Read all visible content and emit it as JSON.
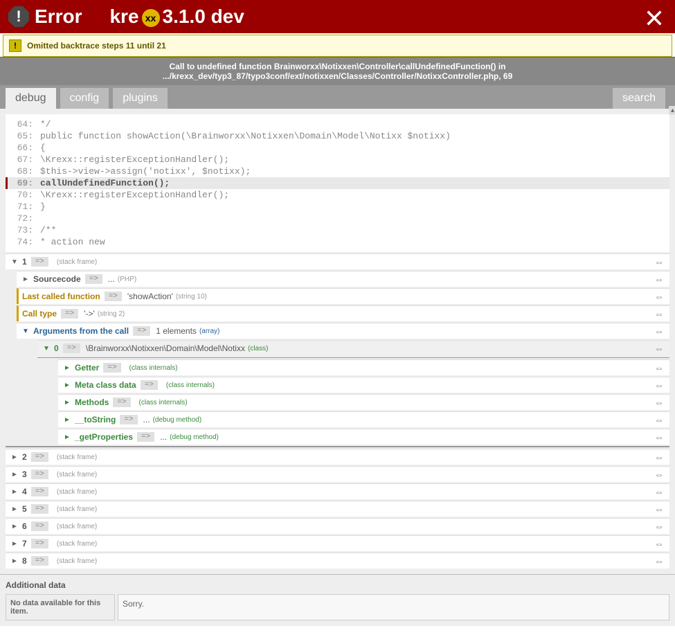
{
  "header": {
    "icon_char": "!",
    "title": "Error",
    "product_prefix": "kre",
    "badge": "xx",
    "version": "3.1.0 dev"
  },
  "notice": {
    "icon_char": "!",
    "text": "Omitted backtrace steps 11 until 21"
  },
  "error_msg": {
    "prefix": "Call to undefined function Brainworxx\\Notixxen\\Controller\\callUndefinedFunction() in ",
    "path": ".../krexx_dev/typ3_87/typo3conf/ext/notixxen/Classes/Controller/NotixxController.php, 69"
  },
  "tabs": {
    "debug": "debug",
    "config": "config",
    "plugins": "plugins",
    "search": "search"
  },
  "code": {
    "l64": "*/",
    "l65": "public function showAction(\\Brainworxx\\Notixxen\\Domain\\Model\\Notixx $notixx)",
    "l66": "{",
    "l67": "    \\Krexx::registerExceptionHandler();",
    "l68": "    $this->view->assign('notixx', $notixx);",
    "l69": "    callUndefinedFunction();",
    "l70": "    \\Krexx::registerExceptionHandler();",
    "l71": "}",
    "l72": "",
    "l73": "/**",
    "l74": " * action new"
  },
  "nodes": {
    "arrow": "=>",
    "ellipsis": "...",
    "stack_frame": "(stack frame)",
    "f1": {
      "key": "1"
    },
    "sourcecode": {
      "key": "Sourcecode",
      "type": "(PHP)"
    },
    "last_called": {
      "key": "Last called function",
      "val": "'showAction'",
      "type": "(string 10)"
    },
    "call_type": {
      "key": "Call type",
      "val": "'->'",
      "type": "(string 2)"
    },
    "args": {
      "key": "Arguments from the call",
      "val": "1 elements",
      "type": "(array)"
    },
    "a0": {
      "key": "0",
      "val": "\\Brainworxx\\Notixxen\\Domain\\Model\\Notixx",
      "type": "(class)"
    },
    "getter": {
      "key": "Getter",
      "type": "(class internals)"
    },
    "meta": {
      "key": "Meta class data",
      "type": "(class internals)"
    },
    "methods": {
      "key": "Methods",
      "type": "(class internals)"
    },
    "tostring": {
      "key": "__toString",
      "type": "(debug method)"
    },
    "getprops": {
      "key": "_getProperties",
      "type": "(debug method)"
    },
    "f2": {
      "key": "2"
    },
    "f3": {
      "key": "3"
    },
    "f4": {
      "key": "4"
    },
    "f5": {
      "key": "5"
    },
    "f6": {
      "key": "6"
    },
    "f7": {
      "key": "7"
    },
    "f8": {
      "key": "8"
    }
  },
  "footer": {
    "title": "Additional data",
    "label": "No data available for this item.",
    "value": "Sorry."
  }
}
